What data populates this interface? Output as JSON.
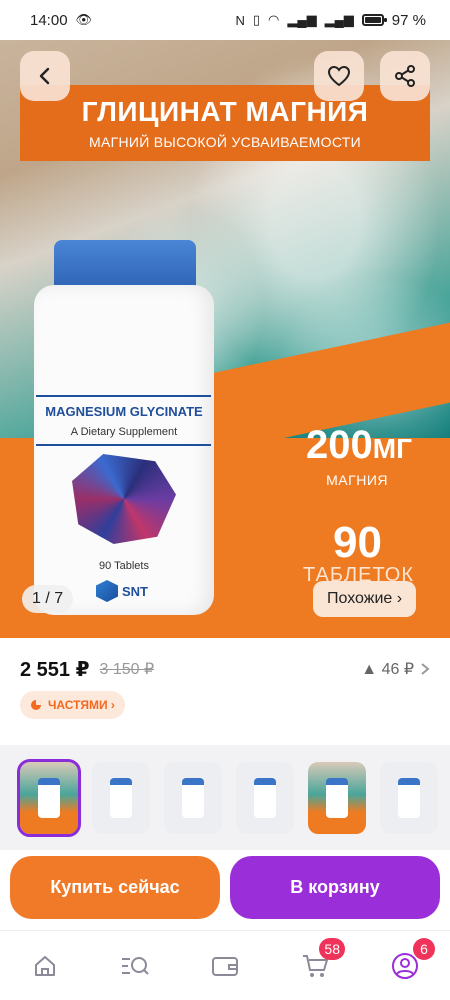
{
  "status_bar": {
    "time": "14:00",
    "battery": "97 %"
  },
  "hero": {
    "title": "ГЛИЦИНАТ МАГНИЯ",
    "subtitle": "МАГНИЙ ВЫСОКОЙ УСВАИВАЕМОСТИ",
    "amount": "200",
    "amount_unit": "МГ",
    "amount_label": "МАГНИЯ",
    "count": "90",
    "count_label": "ТАБЛЕТОК",
    "bottle_brand": "MAGNESIUM GLYCINATE",
    "bottle_desc": "A Dietary Supplement",
    "bottle_count": "90 Tablets",
    "bottle_logo": "SNT",
    "counter_current": "1",
    "counter_total": "/ 7",
    "similar_label": "Похожие ›"
  },
  "price": {
    "current": "2 551 ₽",
    "old": "3 150 ₽",
    "points": "▲ 46 ₽",
    "installments_label": "ЧАСТЯМИ ›"
  },
  "thumbnails": {
    "count": 6,
    "selected_index": 0
  },
  "actions": {
    "buy_now": "Купить сейчас",
    "add_to_cart": "В корзину"
  },
  "nav": {
    "cart_badge": "58",
    "profile_badge": "6"
  },
  "colors": {
    "accent_orange": "#f07a27",
    "accent_purple": "#9a2ed8",
    "badge_red": "#f0335a"
  }
}
